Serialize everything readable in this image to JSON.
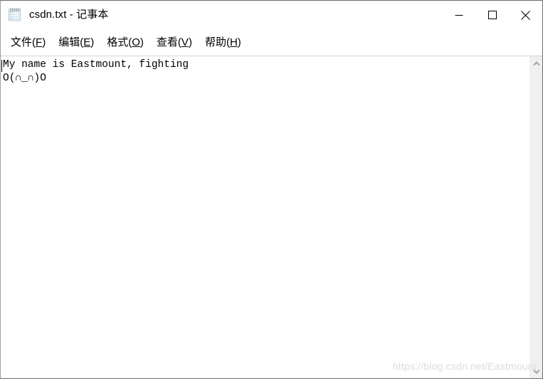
{
  "window": {
    "title": "csdn.txt - 记事本",
    "icon": "notepad-icon",
    "controls": {
      "minimize_label": "—",
      "maximize_label": "□",
      "close_label": "✕"
    }
  },
  "menubar": {
    "items": [
      {
        "label": "文件",
        "accel": "F",
        "full": "文件(F)"
      },
      {
        "label": "编辑",
        "accel": "E",
        "full": "编辑(E)"
      },
      {
        "label": "格式",
        "accel": "O",
        "full": "格式(O)"
      },
      {
        "label": "查看",
        "accel": "V",
        "full": "查看(V)"
      },
      {
        "label": "帮助",
        "accel": "H",
        "full": "帮助(H)"
      }
    ]
  },
  "editor": {
    "lines": [
      "My name is Eastmount, fighting",
      "O(∩_∩)O"
    ]
  },
  "scrollbar": {
    "up_arrow": "chevron-up-icon",
    "down_arrow": "chevron-down-icon"
  },
  "watermark": {
    "text": "https://blog.csdn.net/Eastmount"
  },
  "colors": {
    "window_bg": "#ffffff",
    "border": "#6b6b6b",
    "menu_text": "#000000",
    "scrollbar_track": "#f0f0f0",
    "scrollbar_arrow": "#a3a3a3",
    "watermark": "#dcdcdc"
  }
}
